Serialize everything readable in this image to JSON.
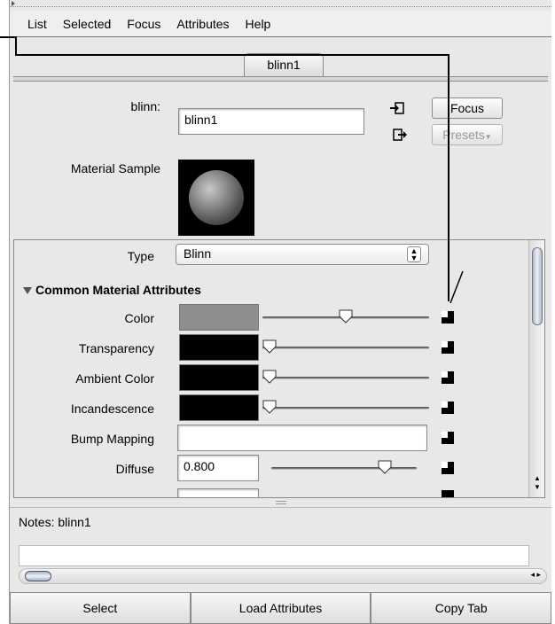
{
  "menu": {
    "items": [
      "List",
      "Selected",
      "Focus",
      "Attributes",
      "Help"
    ]
  },
  "tab": {
    "label": "blinn1"
  },
  "header": {
    "type_label": "blinn:",
    "name_value": "blinn1",
    "focus_button": "Focus",
    "presets_button": "Presets",
    "sample_label": "Material Sample"
  },
  "attributes": {
    "type_label": "Type",
    "type_value": "Blinn",
    "section_title": "Common Material Attributes",
    "rows": [
      {
        "label": "Color",
        "swatch": "#8e8e8e",
        "level": 0.5
      },
      {
        "label": "Transparency",
        "swatch": "#000000",
        "level": 0.0
      },
      {
        "label": "Ambient Color",
        "swatch": "#000000",
        "level": 0.0
      },
      {
        "label": "Incandescence",
        "swatch": "#000000",
        "level": 0.0
      },
      {
        "label": "Bump Mapping"
      },
      {
        "label": "Diffuse",
        "value": "0.800",
        "level": 0.8
      }
    ]
  },
  "notes": {
    "label": "Notes:  blinn1"
  },
  "bottom": {
    "select": "Select",
    "load": "Load Attributes",
    "copy": "Copy Tab"
  }
}
